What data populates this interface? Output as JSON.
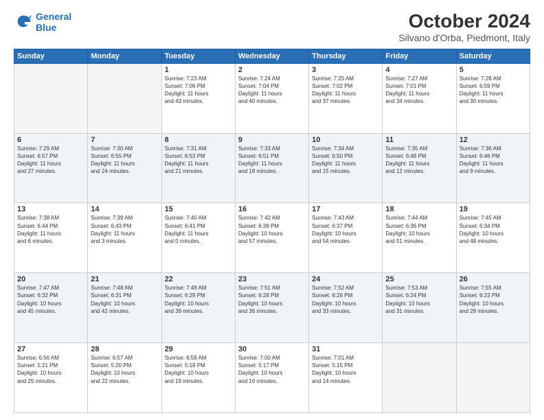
{
  "header": {
    "logo_line1": "General",
    "logo_line2": "Blue",
    "title": "October 2024",
    "subtitle": "Silvano d'Orba, Piedmont, Italy"
  },
  "days_of_week": [
    "Sunday",
    "Monday",
    "Tuesday",
    "Wednesday",
    "Thursday",
    "Friday",
    "Saturday"
  ],
  "weeks": [
    [
      {
        "day": "",
        "info": ""
      },
      {
        "day": "",
        "info": ""
      },
      {
        "day": "1",
        "info": "Sunrise: 7:23 AM\nSunset: 7:06 PM\nDaylight: 11 hours\nand 43 minutes."
      },
      {
        "day": "2",
        "info": "Sunrise: 7:24 AM\nSunset: 7:04 PM\nDaylight: 11 hours\nand 40 minutes."
      },
      {
        "day": "3",
        "info": "Sunrise: 7:25 AM\nSunset: 7:02 PM\nDaylight: 11 hours\nand 37 minutes."
      },
      {
        "day": "4",
        "info": "Sunrise: 7:27 AM\nSunset: 7:01 PM\nDaylight: 11 hours\nand 34 minutes."
      },
      {
        "day": "5",
        "info": "Sunrise: 7:28 AM\nSunset: 6:59 PM\nDaylight: 11 hours\nand 30 minutes."
      }
    ],
    [
      {
        "day": "6",
        "info": "Sunrise: 7:29 AM\nSunset: 6:57 PM\nDaylight: 11 hours\nand 27 minutes."
      },
      {
        "day": "7",
        "info": "Sunrise: 7:30 AM\nSunset: 6:55 PM\nDaylight: 11 hours\nand 24 minutes."
      },
      {
        "day": "8",
        "info": "Sunrise: 7:31 AM\nSunset: 6:53 PM\nDaylight: 11 hours\nand 21 minutes."
      },
      {
        "day": "9",
        "info": "Sunrise: 7:33 AM\nSunset: 6:51 PM\nDaylight: 11 hours\nand 18 minutes."
      },
      {
        "day": "10",
        "info": "Sunrise: 7:34 AM\nSunset: 6:50 PM\nDaylight: 11 hours\nand 15 minutes."
      },
      {
        "day": "11",
        "info": "Sunrise: 7:35 AM\nSunset: 6:48 PM\nDaylight: 11 hours\nand 12 minutes."
      },
      {
        "day": "12",
        "info": "Sunrise: 7:36 AM\nSunset: 6:46 PM\nDaylight: 11 hours\nand 9 minutes."
      }
    ],
    [
      {
        "day": "13",
        "info": "Sunrise: 7:38 AM\nSunset: 6:44 PM\nDaylight: 11 hours\nand 6 minutes."
      },
      {
        "day": "14",
        "info": "Sunrise: 7:39 AM\nSunset: 6:43 PM\nDaylight: 11 hours\nand 3 minutes."
      },
      {
        "day": "15",
        "info": "Sunrise: 7:40 AM\nSunset: 6:41 PM\nDaylight: 11 hours\nand 0 minutes."
      },
      {
        "day": "16",
        "info": "Sunrise: 7:42 AM\nSunset: 6:39 PM\nDaylight: 10 hours\nand 57 minutes."
      },
      {
        "day": "17",
        "info": "Sunrise: 7:43 AM\nSunset: 6:37 PM\nDaylight: 10 hours\nand 54 minutes."
      },
      {
        "day": "18",
        "info": "Sunrise: 7:44 AM\nSunset: 6:36 PM\nDaylight: 10 hours\nand 51 minutes."
      },
      {
        "day": "19",
        "info": "Sunrise: 7:45 AM\nSunset: 6:34 PM\nDaylight: 10 hours\nand 48 minutes."
      }
    ],
    [
      {
        "day": "20",
        "info": "Sunrise: 7:47 AM\nSunset: 6:32 PM\nDaylight: 10 hours\nand 45 minutes."
      },
      {
        "day": "21",
        "info": "Sunrise: 7:48 AM\nSunset: 6:31 PM\nDaylight: 10 hours\nand 42 minutes."
      },
      {
        "day": "22",
        "info": "Sunrise: 7:49 AM\nSunset: 6:29 PM\nDaylight: 10 hours\nand 39 minutes."
      },
      {
        "day": "23",
        "info": "Sunrise: 7:51 AM\nSunset: 6:28 PM\nDaylight: 10 hours\nand 36 minutes."
      },
      {
        "day": "24",
        "info": "Sunrise: 7:52 AM\nSunset: 6:26 PM\nDaylight: 10 hours\nand 33 minutes."
      },
      {
        "day": "25",
        "info": "Sunrise: 7:53 AM\nSunset: 6:24 PM\nDaylight: 10 hours\nand 31 minutes."
      },
      {
        "day": "26",
        "info": "Sunrise: 7:55 AM\nSunset: 6:23 PM\nDaylight: 10 hours\nand 28 minutes."
      }
    ],
    [
      {
        "day": "27",
        "info": "Sunrise: 6:56 AM\nSunset: 5:21 PM\nDaylight: 10 hours\nand 25 minutes."
      },
      {
        "day": "28",
        "info": "Sunrise: 6:57 AM\nSunset: 5:20 PM\nDaylight: 10 hours\nand 22 minutes."
      },
      {
        "day": "29",
        "info": "Sunrise: 6:59 AM\nSunset: 5:18 PM\nDaylight: 10 hours\nand 19 minutes."
      },
      {
        "day": "30",
        "info": "Sunrise: 7:00 AM\nSunset: 5:17 PM\nDaylight: 10 hours\nand 16 minutes."
      },
      {
        "day": "31",
        "info": "Sunrise: 7:01 AM\nSunset: 5:15 PM\nDaylight: 10 hours\nand 14 minutes."
      },
      {
        "day": "",
        "info": ""
      },
      {
        "day": "",
        "info": ""
      }
    ]
  ]
}
